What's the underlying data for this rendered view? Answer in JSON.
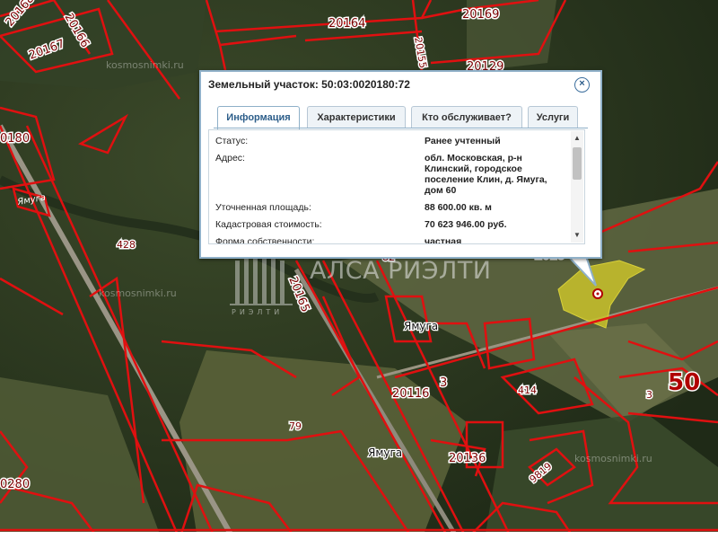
{
  "popup": {
    "title": "Земельный участок: 50:03:0020180:72",
    "close_glyph": "×",
    "tabs": [
      {
        "label": "Информация",
        "active": true
      },
      {
        "label": "Характеристики",
        "active": false
      },
      {
        "label": "Кто обслуживает?",
        "active": false
      },
      {
        "label": "Услуги",
        "active": false
      }
    ],
    "rows": [
      {
        "label": "Статус:",
        "value": "Ранее учтенный"
      },
      {
        "label": "Адрес:",
        "value": "обл. Московская, р-н Клинский, городское поселение Клин, д. Ямуга, дом 60"
      },
      {
        "label": "Уточненная площадь:",
        "value": "88 600.00 кв. м"
      },
      {
        "label": "Кадастровая стоимость:",
        "value": "70 623 946.00 руб."
      },
      {
        "label": "Форма собственности:",
        "value": "частная"
      }
    ],
    "scroll_up_glyph": "▲",
    "scroll_down_glyph": "▼"
  },
  "map": {
    "parcel_labels": [
      "20168",
      "20164",
      "20169",
      "20167",
      "20166",
      "20155",
      "20129",
      "0180",
      "428",
      "20165",
      "82",
      "2018",
      "3",
      "20116",
      "414",
      "79",
      "20136",
      "9819",
      "3",
      "50",
      "0280"
    ],
    "place_labels": [
      "Ямуга",
      "Ямуга"
    ],
    "river_label": "Ямуга",
    "watermarks": [
      "kosmosnimki.ru",
      "kosmosnimki.ru",
      "kosmosnimki.ru"
    ],
    "brand": {
      "name": "АЛСА РИЭЛТИ",
      "sub": "РИЭЛТИ"
    },
    "highlight_color": "#c9c22a",
    "boundary_color": "#e01010"
  }
}
